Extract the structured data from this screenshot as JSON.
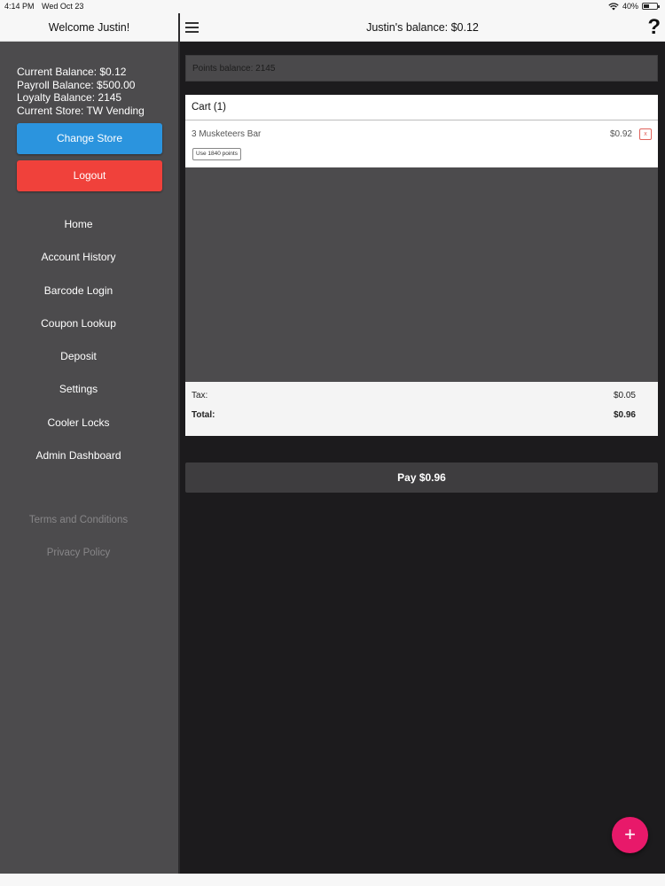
{
  "status_bar": {
    "time": "4:14 PM",
    "date": "Wed Oct 23",
    "battery": "40%",
    "battery_level": 0.4
  },
  "sidebar": {
    "welcome": "Welcome Justin!",
    "balances": [
      "Current Balance: $0.12",
      "Payroll Balance: $500.00",
      "Loyalty Balance: 2145",
      "Current Store: TW Vending"
    ],
    "change_store_label": "Change Store",
    "logout_label": "Logout",
    "nav_items": [
      "Home",
      "Account History",
      "Barcode Login",
      "Coupon Lookup",
      "Deposit",
      "Settings",
      "Cooler Locks",
      "Admin Dashboard"
    ],
    "terms_label": "Terms and Conditions",
    "privacy_label": "Privacy Policy"
  },
  "header": {
    "title": "Justin's balance: $0.12",
    "help_glyph": "?"
  },
  "main": {
    "points_balance": "Points balance: 2145",
    "cart": {
      "title": "Cart (1)",
      "items": [
        {
          "name": "3 Musketeers Bar",
          "price": "$0.92",
          "remove": "x",
          "use_points": "Use 1840 points"
        }
      ],
      "tax_label": "Tax:",
      "tax_value": "$0.05",
      "total_label": "Total:",
      "total_value": "$0.96"
    },
    "pay_label": "Pay $0.96",
    "fab_glyph": "+"
  },
  "colors": {
    "change_store": "#2b94de",
    "logout": "#f0413b",
    "fab": "#e8196a"
  }
}
